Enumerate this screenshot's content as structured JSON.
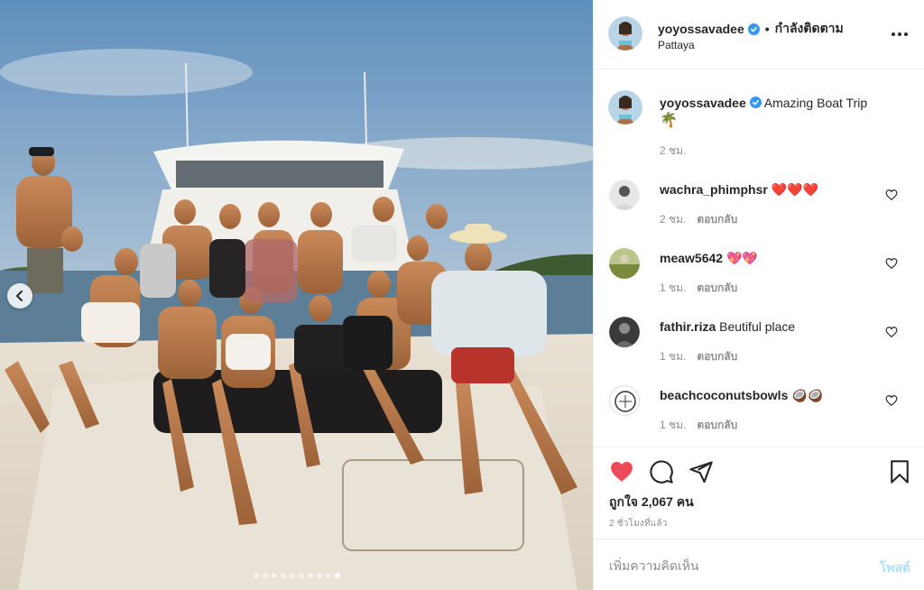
{
  "post": {
    "username": "yoyossavadee",
    "follow_status": "กำลังติดตาม",
    "location": "Pattaya",
    "caption": "Amazing Boat Trip",
    "caption_emoji": "🌴",
    "caption_time": "2 ชม.",
    "likes_text": "ถูกใจ 2,067 คน",
    "time_ago": "2 ชั่วโมงที่แล้ว",
    "carousel_total": 10,
    "carousel_active": 9
  },
  "comments": [
    {
      "username": "wachra_phimphsr",
      "text": "❤️❤️❤️",
      "time": "2 ชม.",
      "reply": "ตอบกลับ"
    },
    {
      "username": "meaw5642",
      "text": "💖💖",
      "time": "1 ชม.",
      "reply": "ตอบกลับ"
    },
    {
      "username": "fathir.riza",
      "text": "Beutiful place",
      "time": "1 ชม.",
      "reply": "ตอบกลับ"
    },
    {
      "username": "beachcoconutsbowls",
      "text": "🥥🥥",
      "time": "1 ชม.",
      "reply": "ตอบกลับ"
    }
  ],
  "comment_box": {
    "placeholder": "เพิ่มความคิดเห็น",
    "post_label": "โพสต์"
  },
  "colors": {
    "like_red": "#ed4956",
    "verified_blue": "#3897f0",
    "post_disabled": "#b2dffc",
    "muted": "#8e8e8e"
  },
  "icons": {
    "like": "heart-filled-icon",
    "comment": "speech-bubble-icon",
    "share": "paper-plane-icon",
    "save": "bookmark-icon",
    "more": "ellipsis-icon",
    "carousel_prev": "chevron-left-icon"
  }
}
